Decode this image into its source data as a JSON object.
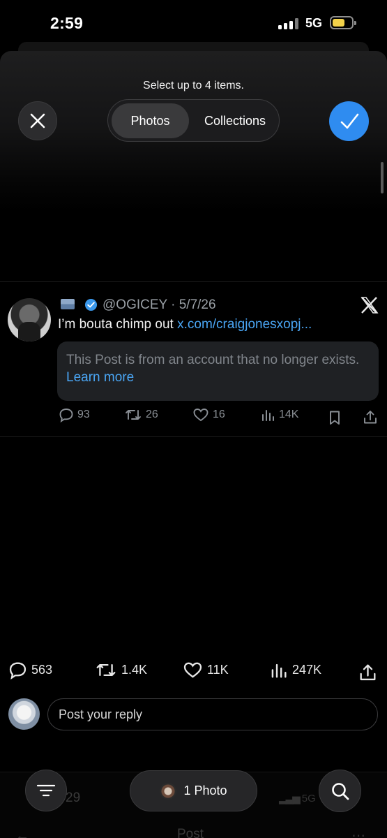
{
  "status_bar": {
    "time": "2:59",
    "network": "5G"
  },
  "picker": {
    "hint": "Select up to 4 items.",
    "tabs": [
      {
        "label": "Photos",
        "selected": true
      },
      {
        "label": "Collections",
        "selected": false
      }
    ],
    "close_icon": "close-icon",
    "confirm_icon": "checkmark-icon",
    "accent_color": "#2f8cf0"
  },
  "embedded_post": {
    "handle_line": "@OGICEY · 5/7/26",
    "text_prefix": "I’m bouta chimp out ",
    "link_text": "x.com/craigjonesxopj...",
    "notice_text": "This Post is from an account that no longer exists. ",
    "learn_more": "Learn more",
    "stats": {
      "replies": "93",
      "reposts": "26",
      "likes": "16",
      "views": "14K"
    }
  },
  "post_stats": {
    "replies": "563",
    "reposts": "1.4K",
    "likes": "11K",
    "views": "247K"
  },
  "reply": {
    "placeholder": "Post your reply"
  },
  "bottom_bar": {
    "selection_label": "1 Photo",
    "background_count": "29",
    "background_status": "5G",
    "background_title": "Post"
  }
}
